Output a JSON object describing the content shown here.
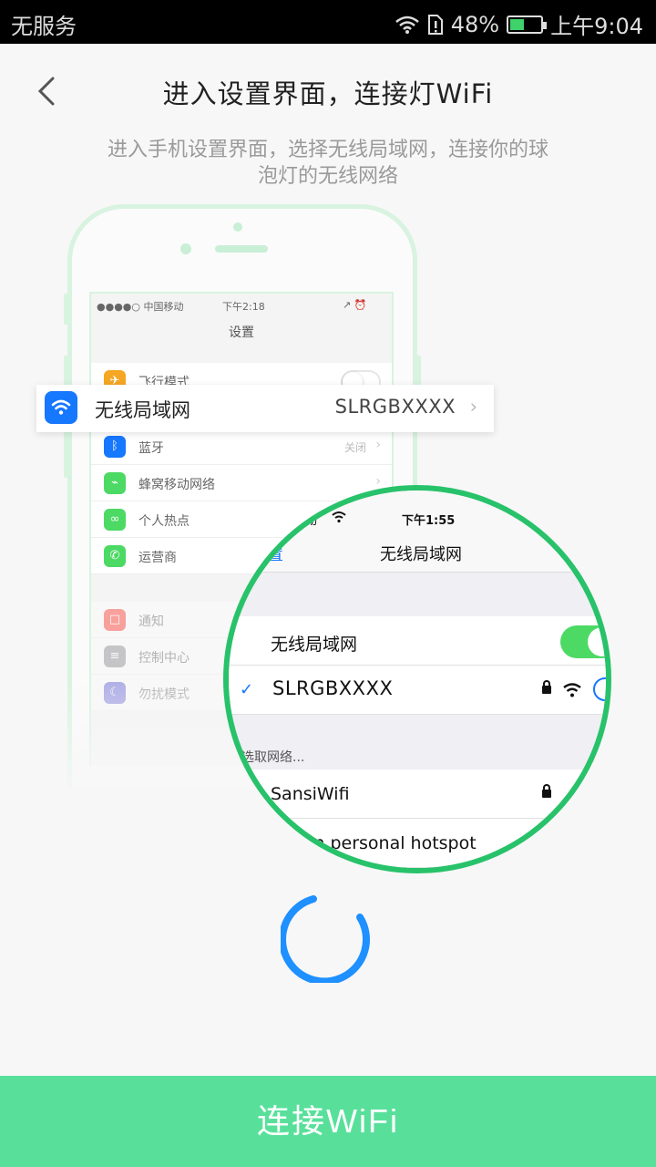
{
  "status_bar": {
    "carrier": "无服务",
    "battery_percent": "48%",
    "battery_level": 0.48,
    "time": "上午9:04"
  },
  "header": {
    "back_icon": "chevron-left-icon",
    "title": "进入设置界面，连接灯WiFi"
  },
  "instructions": "进入手机设置界面，选择无线局域网，连接你的球泡灯的无线网络",
  "illustration": {
    "phone_status": {
      "carrier": "●●●●○ 中国移动",
      "time": "下午2:18",
      "icons": "↗ ⏰"
    },
    "settings_title": "设置",
    "rows": [
      {
        "icon": "airplane-icon",
        "glyph": "✈",
        "color": "#f5a623",
        "label": "飞行模式",
        "value": "",
        "toggle": true
      },
      {
        "icon": "bluetooth-icon",
        "glyph": "ᛒ",
        "color": "#1677ff",
        "label": "蓝牙",
        "value": "关闭",
        "toggle": false
      },
      {
        "icon": "cellular-icon",
        "glyph": "⌁",
        "color": "#4cd964",
        "label": "蜂窝移动网络",
        "value": "",
        "toggle": false
      },
      {
        "icon": "hotspot-icon",
        "glyph": "∞",
        "color": "#4cd964",
        "label": "个人热点",
        "value": "",
        "toggle": false
      },
      {
        "icon": "carrier-icon",
        "glyph": "✆",
        "color": "#4cd964",
        "label": "运营商",
        "value": "",
        "toggle": false
      },
      {
        "icon": "notification-icon",
        "glyph": "□",
        "color": "#ff3b30",
        "label": "通知",
        "value": "",
        "toggle": false
      },
      {
        "icon": "control-center-icon",
        "glyph": "≡",
        "color": "#8e8e93",
        "label": "控制中心",
        "value": "",
        "toggle": false
      },
      {
        "icon": "do-not-disturb-icon",
        "glyph": "☾",
        "color": "#5856d6",
        "label": "勿扰模式",
        "value": "",
        "toggle": false
      }
    ],
    "wifi_row": {
      "icon": "wifi-icon",
      "label": "无线局域网",
      "value": "SLRGBXXXX"
    },
    "magnified": {
      "status_left": "动",
      "time": "下午1:55",
      "back_label": "置",
      "title": "无线局域网",
      "wifi_label": "无线局域网",
      "wifi_enabled": true,
      "connected_network": "SLRGBXXXX",
      "section_label": "选取网络...",
      "networks": [
        "SansiWifi",
        "ican personal hotspot"
      ]
    }
  },
  "loading": true,
  "accent_color": "#1e90ff",
  "button": {
    "label": "连接WiFi",
    "color": "#58e09b"
  }
}
